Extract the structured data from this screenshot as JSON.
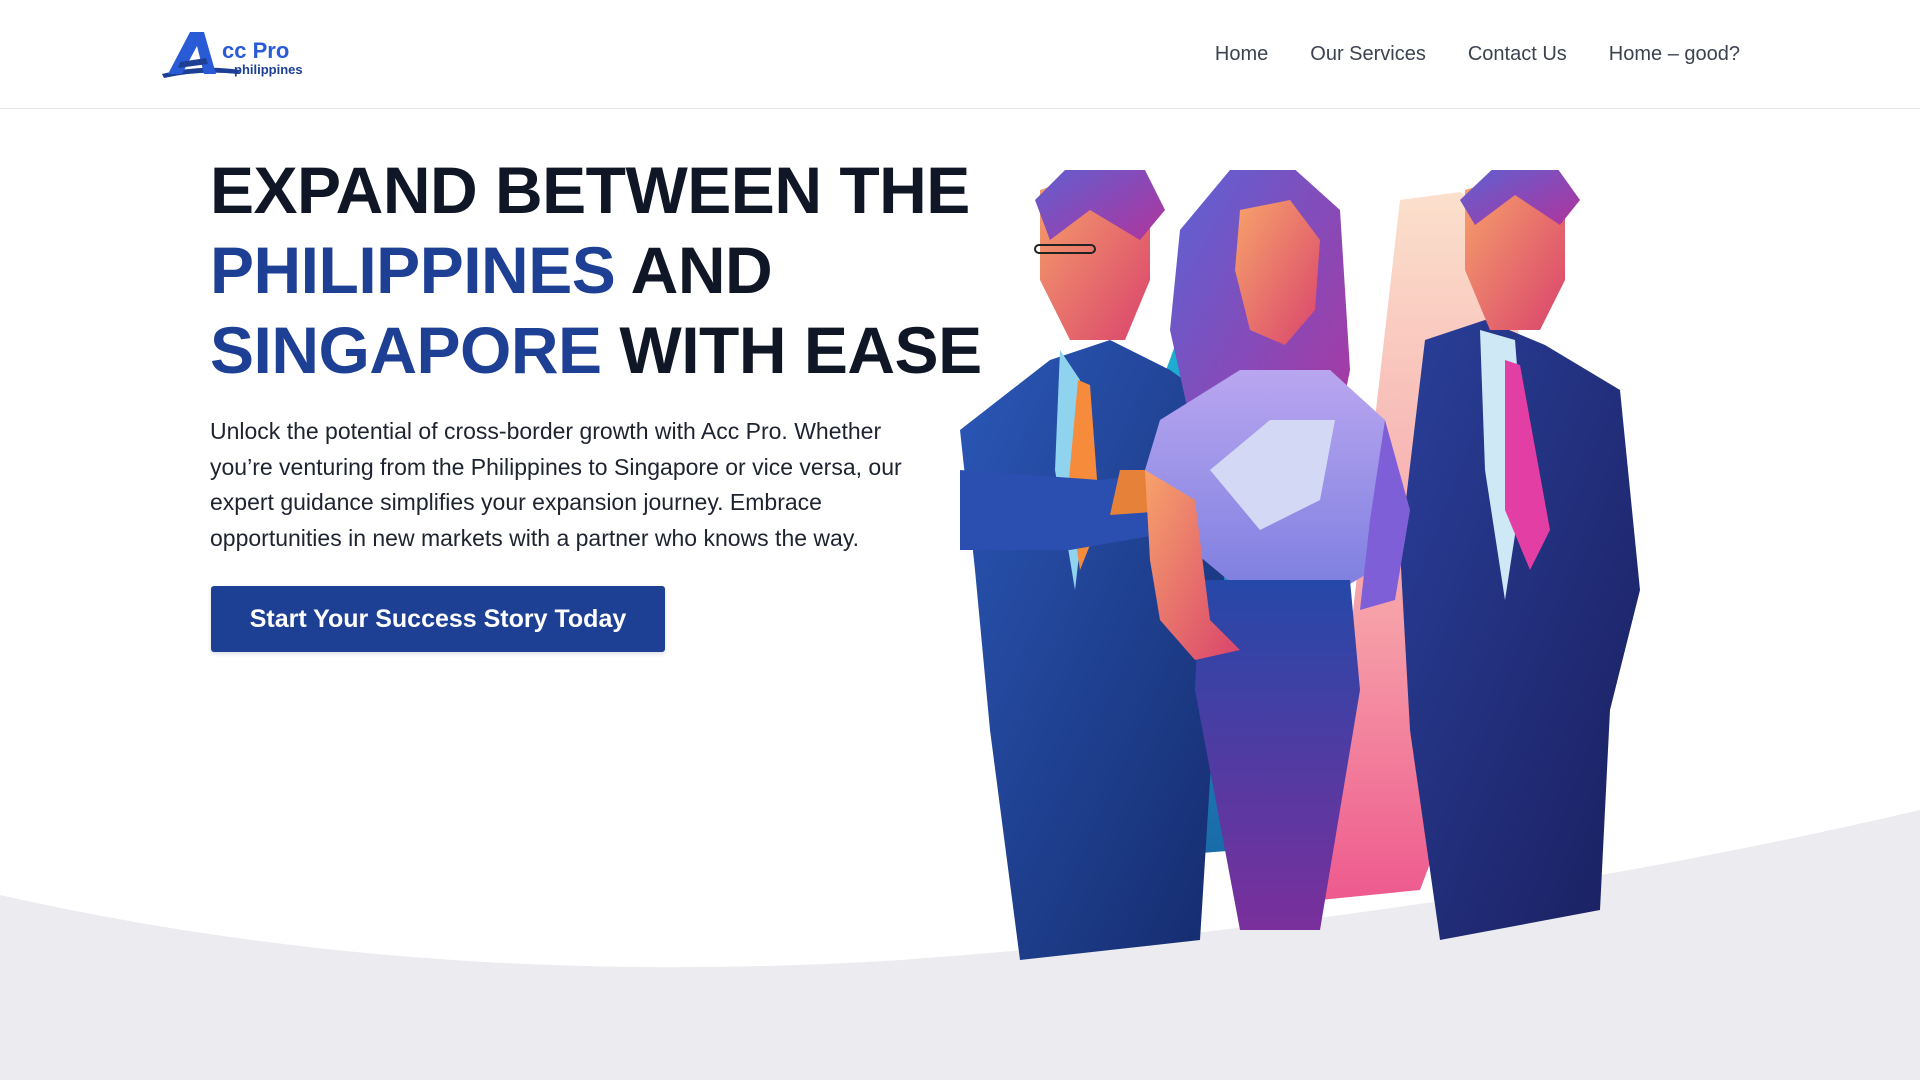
{
  "header": {
    "logo": {
      "brand_text": "Acc Pro",
      "sub_text": "philippines"
    },
    "nav": [
      {
        "label": "Home"
      },
      {
        "label": "Our Services"
      },
      {
        "label": "Contact Us"
      },
      {
        "label": "Home – good?"
      }
    ]
  },
  "hero": {
    "heading": {
      "line1": "EXPAND BETWEEN THE",
      "line2_accent": "PHILIPPINES",
      "line2_rest": " AND",
      "line3_accent": "SINGAPORE",
      "line3_rest": " WITH EASE"
    },
    "paragraph": "Unlock the potential of cross-border growth with Acc Pro. Whether you’re venturing from the Philippines to Singapore or vice versa, our expert guidance simplifies your expansion journey. Embrace opportunities in new markets with a partner who knows the way.",
    "cta_label": "Start Your Success Story Today"
  },
  "colors": {
    "accent_blue": "#1d3f94",
    "heading_dark": "#0f1626",
    "wave_gray": "#ececf0",
    "logo_blue": "#2a5bd7"
  },
  "illustration": {
    "icon": "business-team-illustration"
  }
}
